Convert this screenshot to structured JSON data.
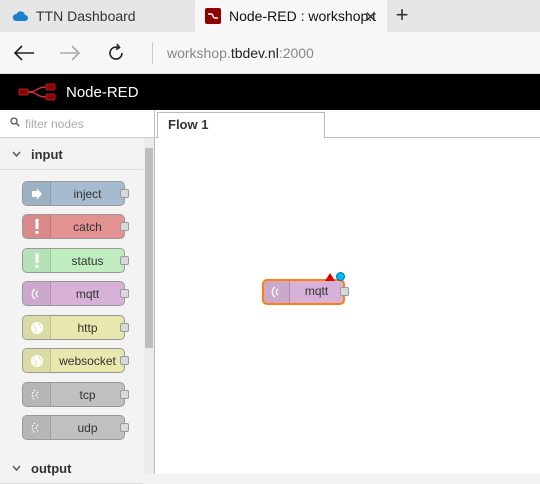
{
  "browser": {
    "tabs": [
      {
        "title": "TTN Dashboard",
        "active": false,
        "icon": "cloud-icon"
      },
      {
        "title": "Node-RED : workshop.t",
        "active": true,
        "icon": "node-red-icon"
      }
    ],
    "close_glyph": "✕",
    "new_tab_glyph": "+",
    "url": {
      "prefix": "workshop.",
      "host": "tbdev.nl",
      "suffix": ":2000"
    }
  },
  "app": {
    "brand": "Node-RED"
  },
  "palette": {
    "filter_placeholder": "filter nodes",
    "categories": [
      {
        "label": "input",
        "expanded": true
      },
      {
        "label": "output",
        "expanded": true
      }
    ],
    "nodes": [
      {
        "label": "inject",
        "color": "#a6bbcf",
        "icon": "arrow-right-icon"
      },
      {
        "label": "catch",
        "color": "#e49191",
        "icon": "exclamation-icon"
      },
      {
        "label": "status",
        "color": "#c0edc0",
        "icon": "exclamation-icon"
      },
      {
        "label": "mqtt",
        "color": "#d7b1d7",
        "icon": "bridge-icon"
      },
      {
        "label": "http",
        "color": "#e7e7ae",
        "icon": "globe-icon"
      },
      {
        "label": "websocket",
        "color": "#e7e7ae",
        "icon": "globe-icon"
      },
      {
        "label": "tcp",
        "color": "#c0c0c0",
        "icon": "bridge-icon"
      },
      {
        "label": "udp",
        "color": "#c0c0c0",
        "icon": "bridge-icon"
      }
    ]
  },
  "workspace": {
    "tabs": [
      {
        "label": "Flow 1"
      }
    ],
    "nodes": [
      {
        "label": "mqtt",
        "color": "#d7b1d7",
        "icon": "bridge-icon",
        "status": [
          "warning",
          "changed"
        ]
      }
    ]
  },
  "colors": {
    "selection": "#ff7f0e",
    "header": "#000000"
  }
}
